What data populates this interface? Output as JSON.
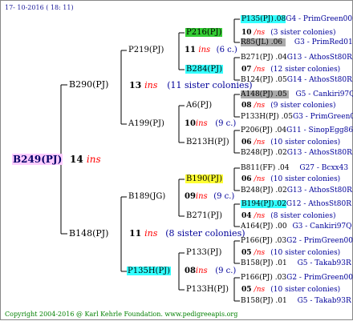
{
  "header": {
    "date": "17- 10-2016 ( 18: 11)"
  },
  "footer": {
    "text": "Copyright 2004-2016 @ Karl Kehrle Foundation.   www.pedigreeapis.org"
  },
  "colors": {
    "root_bg": "#ffccff",
    "green": "#33cc33",
    "cyan": "#33ffff",
    "yellow": "#ffff33",
    "grey": "#aaaaaa",
    "ins": "#ff0000",
    "sister": "#000099"
  },
  "root": {
    "label": "B249(PJ)",
    "gen": "14",
    "ins": "ins"
  },
  "level1": {
    "top": {
      "label": "B290(PJ)",
      "gen": "13",
      "ins": "ins",
      "sisters": "(11 sister colonies)"
    },
    "bottom": {
      "label": "B148(PJ)",
      "gen": "11",
      "ins": "ins",
      "sisters": "(8 sister colonies)"
    }
  },
  "level2": {
    "a": {
      "label": "P219(PJ)",
      "gen": "11",
      "ins": "ins",
      "sisters": "(6 c.)"
    },
    "b": {
      "label": "A199(PJ)",
      "gen": "10",
      "ins": "ins",
      "sisters": "(9 c.)"
    },
    "c": {
      "label": "B189(JG)",
      "gen": "09",
      "ins": "ins",
      "sisters": "(9 c.)"
    },
    "d": {
      "label": "P135H(PJ)",
      "gen": "08",
      "ins": "ins",
      "sisters": "(9 c.)"
    }
  },
  "level3": {
    "a": {
      "label": "P216(PJ)",
      "gen": "10",
      "ins": "/ns",
      "sisters": "(3 sister colonies)"
    },
    "b": {
      "label": "B284(PJ)",
      "gen": "07",
      "ins": "/ns",
      "sisters": "(12 sister colonies)"
    },
    "c": {
      "label": "A6(PJ)",
      "gen": "08",
      "ins": "/ns",
      "sisters": "(9 sister colonies)"
    },
    "d": {
      "label": "B213H(PJ)",
      "gen": "06",
      "ins": "/ns",
      "sisters": "(10 sister colonies)"
    },
    "e": {
      "label": "B190(PJ)",
      "gen": "06",
      "ins": "/ns",
      "sisters": "(10 sister colonies)"
    },
    "f": {
      "label": "B271(PJ)",
      "gen": "04",
      "ins": "/ns",
      "sisters": "(8 sister colonies)"
    },
    "g": {
      "label": "P133(PJ)",
      "gen": "05",
      "ins": "/ns",
      "sisters": "(10 sister colonies)"
    },
    "h": {
      "label": "P133H(PJ)",
      "gen": "05",
      "ins": "/ns",
      "sisters": "(10 sister colonies)"
    }
  },
  "level4": {
    "a1": {
      "label": "P135(PJ)",
      "year": ".08",
      "bee": "G4 - PrimGreen00"
    },
    "a2": {
      "label": "R85(JL)",
      "year": ".06",
      "bee": "G3 - PrimRed01"
    },
    "b1": {
      "label": "B271(PJ)",
      "year": ".04",
      "bee": "G13 - AthosSt80R"
    },
    "b2": {
      "label": "B124(PJ)",
      "year": ".05",
      "bee": "G14 - AthosSt80R"
    },
    "c1": {
      "label": "A148(PJ)",
      "year": ".05",
      "bee": "G5 - Cankiri97Q"
    },
    "c2": {
      "label": "P133H(PJ)",
      "year": ".05",
      "bee": "G3 - PrimGreen00"
    },
    "d1": {
      "label": "P206(PJ)",
      "year": ".04",
      "bee": "G11 - SinopEgg86R"
    },
    "d2": {
      "label": "B248(PJ)",
      "year": ".02",
      "bee": "G13 - AthosSt80R"
    },
    "e1": {
      "label": "B811(FF)",
      "year": ".04",
      "bee": "G27 - Bcxx43"
    },
    "e2": {
      "label": "B248(PJ)",
      "year": ".02",
      "bee": "G13 - AthosSt80R"
    },
    "f1": {
      "label": "B194(PJ)",
      "year": ".02",
      "bee": "G12 - AthosSt80R"
    },
    "f2": {
      "label": "A164(PJ)",
      "year": ".00",
      "bee": "G3 - Cankiri97Q"
    },
    "g1": {
      "label": "P166(PJ)",
      "year": ".03",
      "bee": "G2 - PrimGreen00"
    },
    "g2": {
      "label": "B158(PJ)",
      "year": ".01",
      "bee": "G5 - Takab93R"
    },
    "h1": {
      "label": "P166(PJ)",
      "year": ".03",
      "bee": "G2 - PrimGreen00"
    },
    "h2": {
      "label": "B158(PJ)",
      "year": ".01",
      "bee": "G5 - Takab93R"
    }
  }
}
